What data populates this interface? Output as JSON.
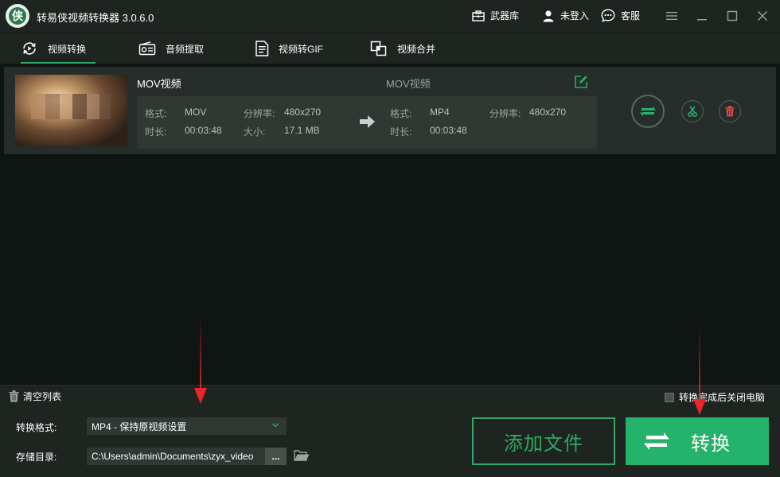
{
  "app": {
    "title": "转易侠视频转换器 3.0.6.0",
    "logo_glyph": "侠"
  },
  "titlebar": {
    "arsenal_label": "武器库",
    "login_label": "未登入",
    "service_label": "客服",
    "menu_icon": "hamburger-icon",
    "minimize_icon": "minimize-icon",
    "maximize_icon": "maximize-icon",
    "close_icon": "close-icon"
  },
  "tabs": [
    {
      "label": "视频转换",
      "icon": "video-convert-icon",
      "active": true
    },
    {
      "label": "音频提取",
      "icon": "radio-icon",
      "active": false
    },
    {
      "label": "视频转GIF",
      "icon": "document-gif-icon",
      "active": false
    },
    {
      "label": "视频合并",
      "icon": "merge-icon",
      "active": false
    }
  ],
  "file": {
    "source_name": "MOV视频",
    "target_name": "MOV视频",
    "source": {
      "format_label": "格式:",
      "format": "MOV",
      "resolution_label": "分辨率:",
      "resolution": "480x270",
      "duration_label": "时长:",
      "duration": "00:03:48",
      "size_label": "大小:",
      "size": "17.1 MB"
    },
    "target": {
      "format_label": "格式:",
      "format": "MP4",
      "resolution_label": "分辨率:",
      "resolution": "480x270",
      "duration_label": "时长:",
      "duration": "00:03:48"
    }
  },
  "strip": {
    "clear_label": "清空列表",
    "shutdown_label": "转换完成后关闭电脑",
    "shutdown_checked": false
  },
  "bottom": {
    "format_label": "转换格式:",
    "format_value": "MP4 - 保持原视频设置",
    "dir_label": "存储目录:",
    "dir_value": "C:\\Users\\admin\\Documents\\zyx_video",
    "browse_label": "...",
    "add_button": "添加文件",
    "convert_button": "转换"
  },
  "colors": {
    "accent": "#25b26a",
    "background": "#0e1512",
    "panel": "#1e2420",
    "annotation": "#e8262b"
  }
}
